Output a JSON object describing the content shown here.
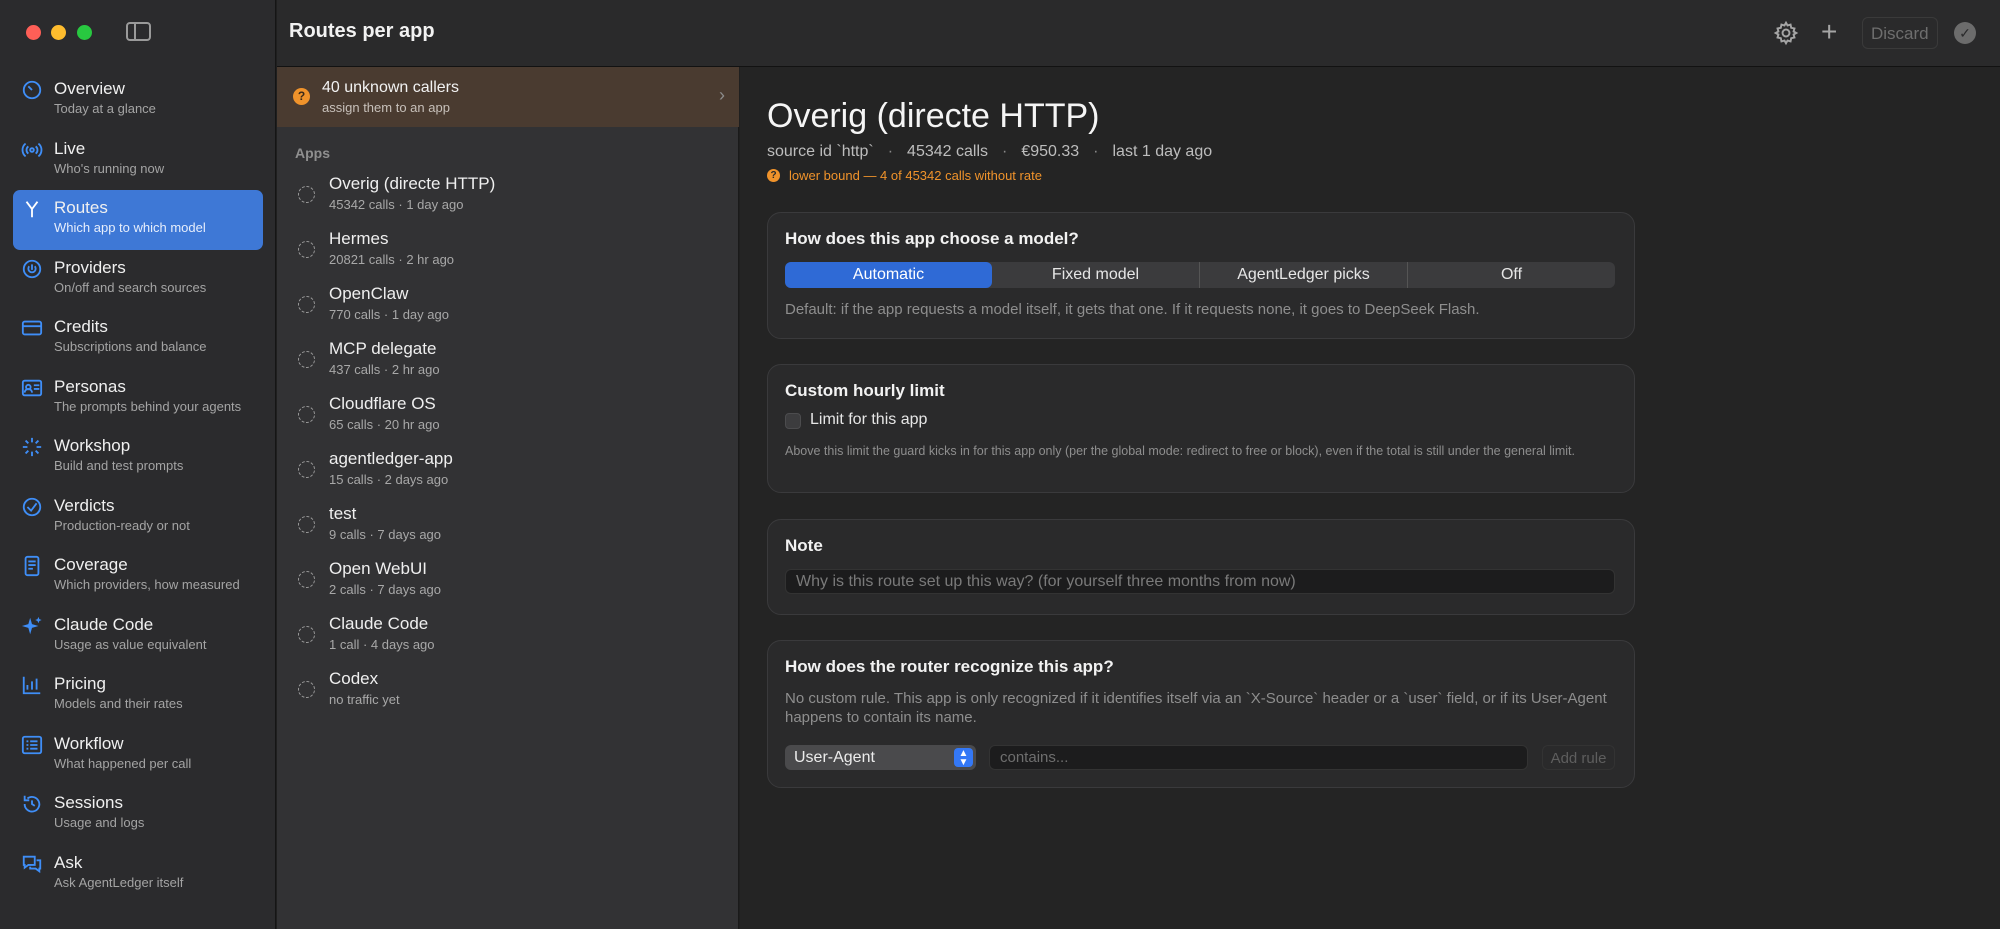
{
  "window": {
    "title": "Routes per app"
  },
  "toolbar": {
    "discard_label": "Discard",
    "settings_icon": "gear-icon",
    "add_icon": "plus-icon",
    "confirm_icon": "checkmark-icon"
  },
  "sidebar": {
    "items": [
      {
        "label": "Overview",
        "sub": "Today at a glance",
        "icon": "gauge-icon",
        "active": false
      },
      {
        "label": "Live",
        "sub": "Who's running now",
        "icon": "broadcast-icon",
        "active": false
      },
      {
        "label": "Routes",
        "sub": "Which app to which model",
        "icon": "branch-icon",
        "active": true
      },
      {
        "label": "Providers",
        "sub": "On/off and search sources",
        "icon": "power-icon",
        "active": false
      },
      {
        "label": "Credits",
        "sub": "Subscriptions and balance",
        "icon": "credit-card-icon",
        "active": false
      },
      {
        "label": "Personas",
        "sub": "The prompts behind your agents",
        "icon": "person-card-icon",
        "active": false
      },
      {
        "label": "Workshop",
        "sub": "Build and test prompts",
        "icon": "sparkle-burst-icon",
        "active": false
      },
      {
        "label": "Verdicts",
        "sub": "Production-ready or not",
        "icon": "checkmark-circle-icon",
        "active": false
      },
      {
        "label": "Coverage",
        "sub": "Which providers, how measured",
        "icon": "document-icon",
        "active": false
      },
      {
        "label": "Claude Code",
        "sub": "Usage as value equivalent",
        "icon": "sparkles-icon",
        "active": false
      },
      {
        "label": "Pricing",
        "sub": "Models and their rates",
        "icon": "chart-bar-icon",
        "active": false
      },
      {
        "label": "Workflow",
        "sub": "What happened per call",
        "icon": "list-icon",
        "active": false
      },
      {
        "label": "Sessions",
        "sub": "Usage and logs",
        "icon": "history-icon",
        "active": false
      },
      {
        "label": "Ask",
        "sub": "Ask AgentLedger itself",
        "icon": "chat-bubbles-icon",
        "active": false
      }
    ]
  },
  "applist": {
    "unknown": {
      "title": "40 unknown callers",
      "sub": "assign them to an app"
    },
    "header": "Apps",
    "apps": [
      {
        "name": "Overig (directe HTTP)",
        "meta": "45342 calls  ·  1 day ago"
      },
      {
        "name": "Hermes",
        "meta": "20821 calls  ·  2 hr ago"
      },
      {
        "name": "OpenClaw",
        "meta": "770 calls  ·  1 day ago"
      },
      {
        "name": "MCP delegate",
        "meta": "437 calls  ·  2 hr ago"
      },
      {
        "name": "Cloudflare OS",
        "meta": "65 calls  ·  20 hr ago"
      },
      {
        "name": "agentledger-app",
        "meta": "15 calls  ·  2 days ago"
      },
      {
        "name": "test",
        "meta": "9 calls  ·  7 days ago"
      },
      {
        "name": "Open WebUI",
        "meta": "2 calls  ·  7 days ago"
      },
      {
        "name": "Claude Code",
        "meta": "1 call  ·  4 days ago"
      },
      {
        "name": "Codex",
        "meta": "no traffic yet"
      }
    ]
  },
  "detail": {
    "title": "Overig (directe HTTP)",
    "meta": {
      "source": "source id `http`",
      "calls": "45342 calls",
      "cost": "€950.33",
      "last": "last 1 day ago"
    },
    "warning": "lower bound — 4 of 45342 calls without rate",
    "model_card": {
      "title": "How does this app choose a model?",
      "options": [
        "Automatic",
        "Fixed model",
        "AgentLedger picks",
        "Off"
      ],
      "selected": "Automatic",
      "description": "Default: if the app requests a model itself, it gets that one. If it requests none, it goes to DeepSeek Flash."
    },
    "limit_card": {
      "title": "Custom hourly limit",
      "checkbox_label": "Limit for this app",
      "checked": false,
      "description": "Above this limit the guard kicks in for this app only (per the global mode: redirect to free or block), even if the total is still under the general limit."
    },
    "note_card": {
      "title": "Note",
      "placeholder": "Why is this route set up this way? (for yourself three months from now)"
    },
    "router_card": {
      "title": "How does the router recognize this app?",
      "description": "No custom rule. This app is only recognized if it identifies itself via an `X-Source` header or a `user` field, or if its User-Agent happens to contain its name.",
      "select_value": "User-Agent",
      "input_placeholder": "contains...",
      "button_label": "Add rule"
    }
  }
}
